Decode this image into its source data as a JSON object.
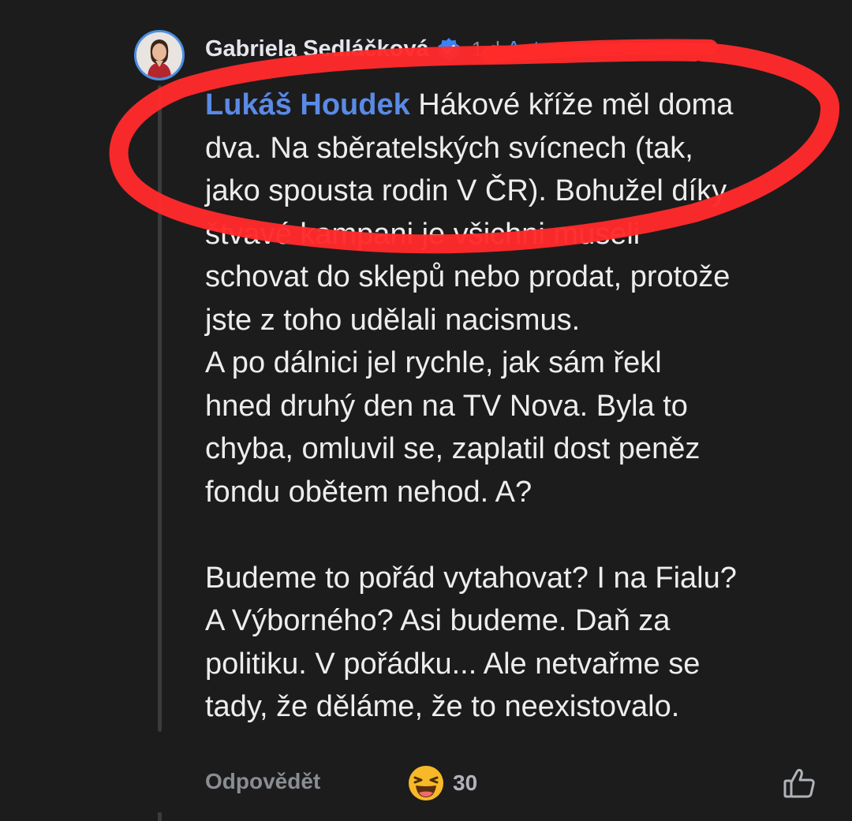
{
  "comment": {
    "author": "Gabriela Sedláčková",
    "time": "1 d",
    "author_badge": "Autor",
    "mention": "Lukáš Houdek",
    "lines": [
      "Hákové kříže měl doma",
      "dva. Na sběratelských svícnech (tak,",
      "jako spousta rodin V ČR). Bohužel díky",
      "štvavé kampani je všichni museli",
      "schovat do sklepů nebo prodat, protože",
      "jste z toho udělali nacismus.",
      "A po dálnici jel rychle, jak sám řekl",
      "hned druhý den na TV Nova. Byla to",
      "chyba, omluvil se, zaplatil dost peněz",
      "fondu obětem nehod. A?",
      "",
      "Budeme to pořád vytahovat? I na Fialu?",
      "A Výborného? Asi budeme. Daň za",
      "politiku. V pořádku... Ale netvařme se",
      "tady, že děláme, že to neexistovalo."
    ]
  },
  "footer": {
    "reply_label": "Odpovědět",
    "reaction_icon": "laughing-emoji-icon",
    "reaction_count": "30",
    "like_icon": "thumbs-up-icon"
  },
  "colors": {
    "background": "#1c1c1d",
    "text": "#ededed",
    "mention": "#5a8ae6",
    "badge": "#4a90e2",
    "muted": "#8a8d91",
    "annotation_red": "#ff2a2a"
  }
}
